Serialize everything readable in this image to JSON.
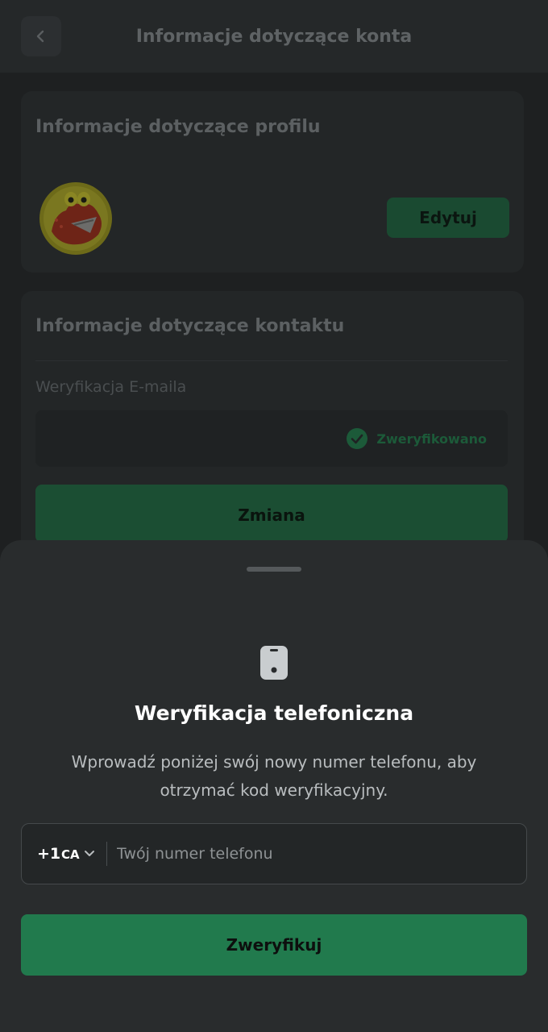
{
  "header": {
    "title": "Informacje dotyczące konta"
  },
  "profile_card": {
    "title": "Informacje dotyczące profilu",
    "edit_label": "Edytuj"
  },
  "contact_card": {
    "title": "Informacje dotyczące kontaktu",
    "email_label": "Weryfikacja E-maila",
    "email_status": "Zweryfikowano",
    "change_label": "Zmiana"
  },
  "sheet": {
    "icon": "phone-icon",
    "title": "Weryfikacja telefoniczna",
    "description": "Wprowadź poniżej swój nowy numer telefonu, aby otrzymać kod weryfikacyjny.",
    "dial_code": "+1",
    "country": "CA",
    "phone_placeholder": "Twój numer telefonu",
    "phone_value": "",
    "verify_label": "Zweryfikuj"
  },
  "colors": {
    "accent": "#217a4d",
    "sheet_bg": "#292c2d",
    "overlay_bg": "#1e2021"
  }
}
